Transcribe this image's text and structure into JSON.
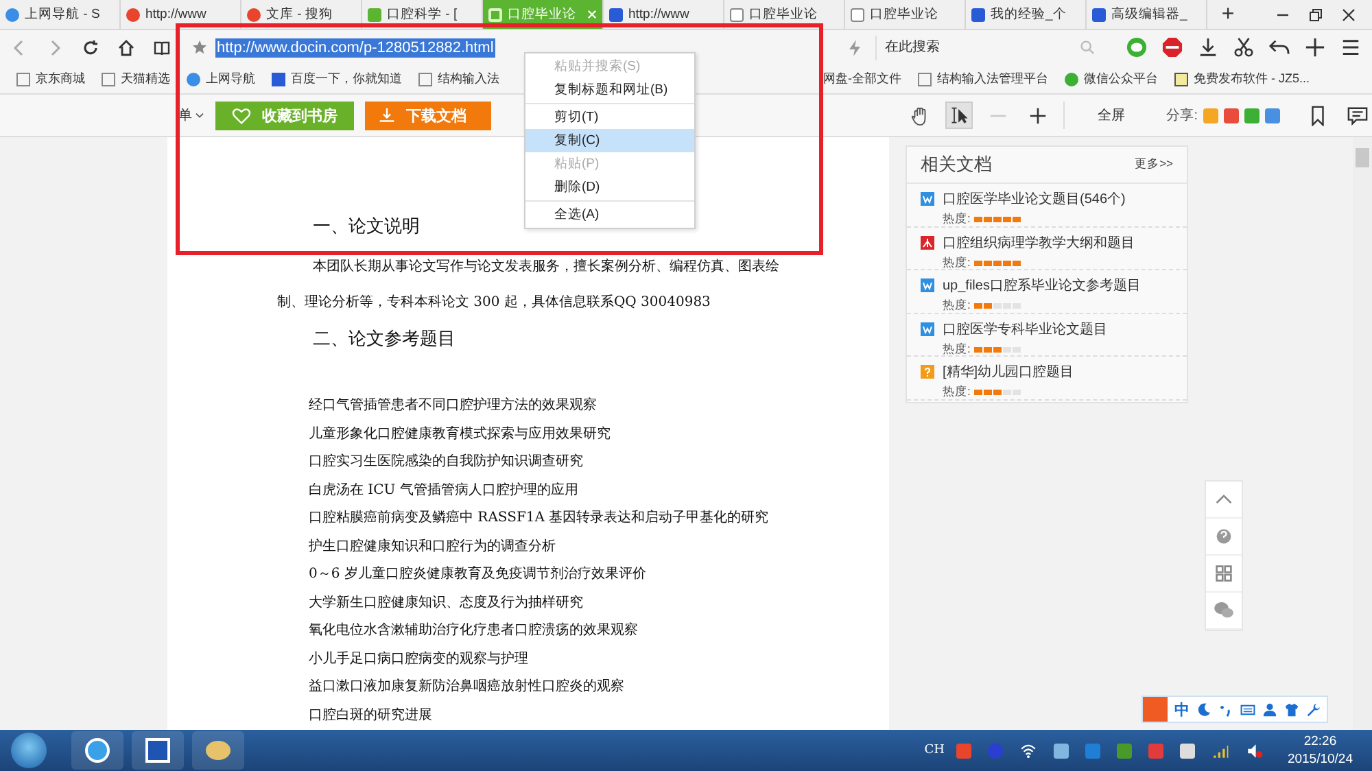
{
  "tabs": [
    {
      "title": "上网导航 - S",
      "selected": false
    },
    {
      "title": "http://www",
      "selected": false
    },
    {
      "title": "文库 - 搜狗",
      "selected": false
    },
    {
      "title": "口腔科学 - [",
      "selected": false
    },
    {
      "title": "口腔毕业论",
      "selected": true
    },
    {
      "title": "http://www",
      "selected": false
    },
    {
      "title": "口腔毕业论",
      "selected": false
    },
    {
      "title": "口腔毕业论",
      "selected": false
    },
    {
      "title": "我的经验_个",
      "selected": false
    },
    {
      "title": "高级编辑器_",
      "selected": false
    }
  ],
  "new_tab": "+",
  "address": {
    "url": "http://www.docin.com/p-1280512882.html",
    "url_selected": true,
    "search_placeholder": "在此搜索"
  },
  "bookmarks": [
    "京东商城",
    "天猫精选",
    "上网导航",
    "百度一下，你就知道",
    "结构输入法",
    "网盘-全部文件",
    "结构输入法管理平台",
    "微信公众平台",
    "免费发布软件 - JZ5..."
  ],
  "context_menu": {
    "groups": [
      [
        {
          "label": "粘贴并搜索(S)",
          "disabled": true,
          "selected": false
        },
        {
          "label": "复制标题和网址(B)",
          "disabled": false,
          "selected": false
        }
      ],
      [
        {
          "label": "剪切(T)",
          "disabled": false,
          "selected": false
        },
        {
          "label": "复制(C)",
          "disabled": false,
          "selected": true
        },
        {
          "label": "粘贴(P)",
          "disabled": true,
          "selected": false
        },
        {
          "label": "删除(D)",
          "disabled": false,
          "selected": false
        }
      ],
      [
        {
          "label": "全选(A)",
          "disabled": false,
          "selected": false
        }
      ]
    ]
  },
  "doc_toolbar": {
    "menu": "单",
    "collect": "收藏到书房",
    "download": "下载文档",
    "select_tool_selected": true,
    "fullscreen": "全屏",
    "share": "分享:"
  },
  "document": {
    "heading_1": "一、论文说明",
    "paragraph": "本团队长期从事论文写作与论文发表服务，擅长案例分析、编程仿真、图表绘制、理论分析等，专科本科论文 300 起，具体信息联系QQ 30040983",
    "heading_2": "二、论文参考题目",
    "topics": [
      "经口气管插管患者不同口腔护理方法的效果观察",
      "儿童形象化口腔健康教育模式探索与应用效果研究",
      "口腔实习生医院感染的自我防护知识调查研究",
      "白虎汤在 ICU 气管插管病人口腔护理的应用",
      "口腔粘膜癌前病变及鳞癌中 RASSF1A 基因转录表达和启动子甲基化的研究",
      "护生口腔健康知识和口腔行为的调查分析",
      "0～6 岁儿童口腔炎健康教育及免疫调节剂治疗效果评价",
      "大学新生口腔健康知识、态度及行为抽样研究",
      "氧化电位水含漱辅助治疗化疗患者口腔溃疡的效果观察",
      "小儿手足口病口腔病变的观察与护理",
      "益口漱口液加康复新防治鼻咽癌放射性口腔炎的观察",
      "口腔白斑的研究进展"
    ]
  },
  "related": {
    "title": "相关文档",
    "more": "更多>>",
    "items": [
      {
        "title": "口腔医学毕业论文题目(546个)",
        "kind": "word",
        "heat_label": "热度:",
        "stars": 5
      },
      {
        "title": "口腔组织病理学教学大纲和题目",
        "kind": "pdf",
        "heat_label": "热度:",
        "stars": 5
      },
      {
        "title": "up_files口腔系毕业论文参考题目",
        "kind": "word",
        "heat_label": "热度:",
        "stars": 2
      },
      {
        "title": "口腔医学专科毕业论文题目",
        "kind": "word",
        "heat_label": "热度:",
        "stars": 3
      },
      {
        "title": "[精华]幼儿园口腔题目",
        "kind": "other",
        "heat_label": "热度:",
        "stars": 3
      }
    ]
  },
  "ime_bar": {
    "mode": "中"
  },
  "taskbar": {
    "lang": "CH",
    "time": "22:26",
    "date": "2015/10/24"
  }
}
